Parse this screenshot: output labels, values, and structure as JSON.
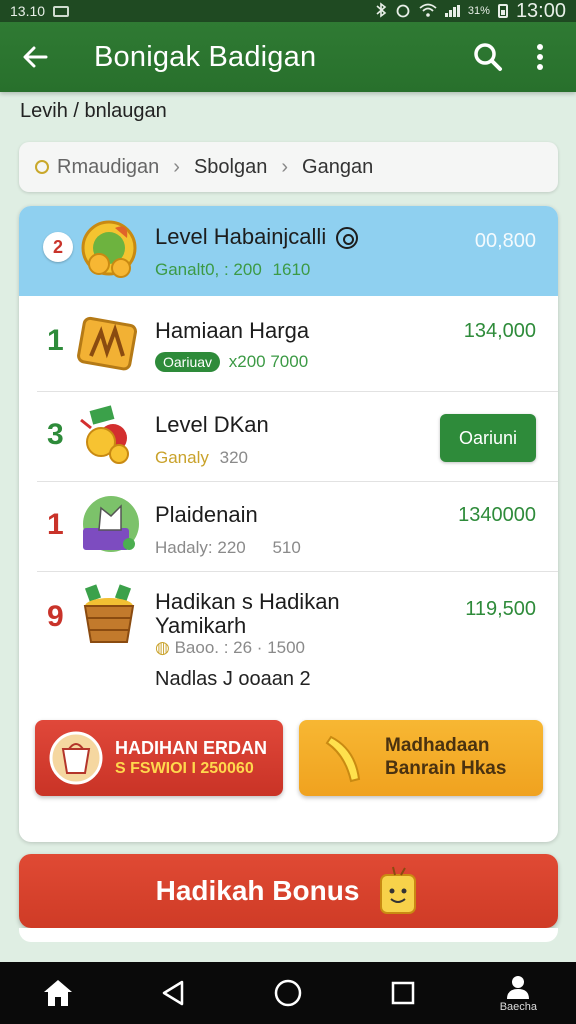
{
  "status_bar": {
    "left_time": "13.10",
    "battery_percent": "31%",
    "time": "13:00"
  },
  "app_bar": {
    "title": "Bonigak Badigan"
  },
  "subtitle": "Levih / bnlaugan",
  "breadcrumb": {
    "items": [
      "Rmaudigan",
      "Sbolgan",
      "Gangan"
    ]
  },
  "list": {
    "header": {
      "badge": "2",
      "title": "Level Habainjcalli",
      "sub": "Ganalt0, : 200",
      "sub2": "1610",
      "value": "00,800"
    },
    "rows": [
      {
        "rank": "1",
        "title": "Hamiaan Harga",
        "chip": "Oariuav",
        "sub": "x200 7000",
        "value": "134,000"
      },
      {
        "rank": "3",
        "title": "Level DKan",
        "sub": "Ganaly",
        "sub2": "320",
        "button": "Oariuni"
      },
      {
        "rank": "1",
        "title": "Plaidenain",
        "sub": "Hadaly: 220",
        "sub2": "510",
        "value": "1340000"
      },
      {
        "rank": "9",
        "title_line1": "Hadikan s Hadikan",
        "title_line2": "Yamikarh",
        "sub": "Baoo. : 26 · 1500",
        "value": "119,500"
      }
    ],
    "footnote": "Nadlas J ooaan 2"
  },
  "promos": {
    "left_line1": "HADIHAN ERDAN",
    "left_line2": "S FSWIOI I 250060",
    "right_line1": "Madhadaan",
    "right_line2": "Banrain Hkas"
  },
  "bonus_button": "Hadikah Bonus",
  "nav": {
    "profile_label": "Baecha"
  },
  "colors": {
    "primary_green": "#2f7a33",
    "header_blue": "#8fd0f0",
    "accent_red": "#d73c2c",
    "accent_orange": "#f4ab26"
  }
}
